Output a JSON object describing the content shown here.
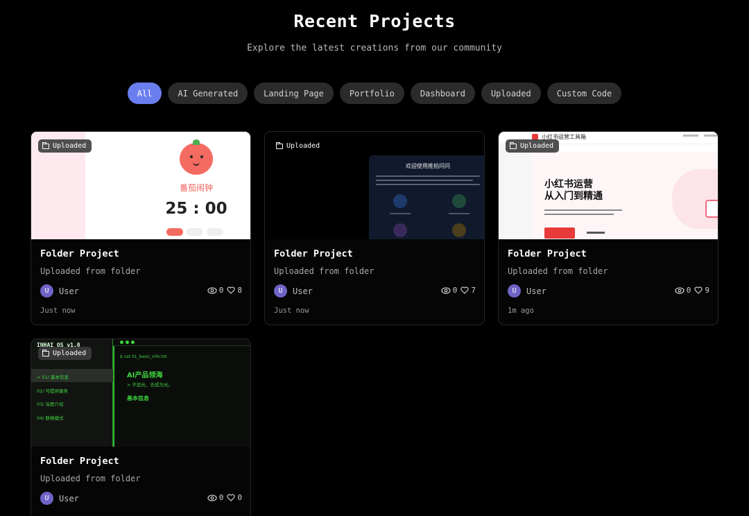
{
  "header": {
    "title": "Recent Projects",
    "subtitle": "Explore the latest creations from our community"
  },
  "filters": [
    {
      "label": "All",
      "active": true
    },
    {
      "label": "AI Generated",
      "active": false
    },
    {
      "label": "Landing Page",
      "active": false
    },
    {
      "label": "Portfolio",
      "active": false
    },
    {
      "label": "Dashboard",
      "active": false
    },
    {
      "label": "Uploaded",
      "active": false
    },
    {
      "label": "Custom Code",
      "active": false
    }
  ],
  "colors": {
    "accent": "#6b7ef0",
    "avatar": "#6f63c7",
    "background": "#000000"
  },
  "cards": [
    {
      "badge": "Uploaded",
      "title": "Folder Project",
      "description": "Uploaded from folder",
      "author_initial": "U",
      "author": "User",
      "views": "0",
      "likes": "8",
      "time": "Just now",
      "preview": {
        "app_name": "番茄闹钟",
        "timer": "25 : 00"
      }
    },
    {
      "badge": "Uploaded",
      "title": "Folder Project",
      "description": "Uploaded from folder",
      "author_initial": "U",
      "author": "User",
      "views": "0",
      "likes": "7",
      "time": "Just now",
      "preview": {
        "heading": "欢迎使用推拍问问"
      }
    },
    {
      "badge": "Uploaded",
      "title": "Folder Project",
      "description": "Uploaded from folder",
      "author_initial": "U",
      "author": "User",
      "views": "0",
      "likes": "9",
      "time": "1m ago",
      "preview": {
        "brand": "小红书运营工具箱",
        "headline_1": "小红书运营",
        "headline_2": "从入门到精通"
      }
    },
    {
      "badge": "Uploaded",
      "title": "Folder Project",
      "description": "Uploaded from folder",
      "author_initial": "U",
      "author": "User",
      "views": "0",
      "likes": "0",
      "time": "",
      "preview": {
        "os_name": "INHAI OS v1.0",
        "command": "$ cat 01_basic_info.txt",
        "heading": "AI产品领海",
        "tagline": "> 不追光，去成为光。",
        "section": "基本信息",
        "menu": [
          "> 01/ 基本信息",
          "02/ 可提供服务",
          "03/ 深度介绍",
          "04/ 联络模式"
        ]
      }
    }
  ]
}
